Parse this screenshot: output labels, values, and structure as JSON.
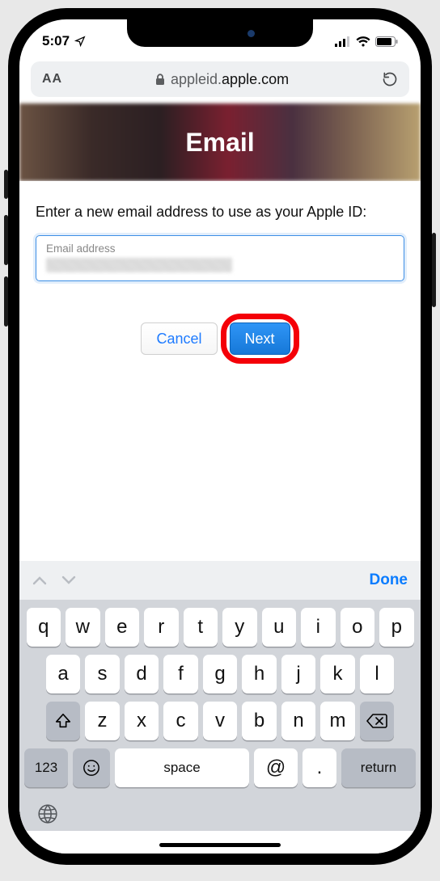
{
  "status": {
    "time": "5:07"
  },
  "urlbar": {
    "text_size_label": "AA",
    "domain_prefix": "appleid.",
    "domain_main": "apple.com"
  },
  "header": {
    "title": "Email"
  },
  "form": {
    "prompt": "Enter a new email address to use as your Apple ID:",
    "field_label": "Email address",
    "cancel_label": "Cancel",
    "next_label": "Next"
  },
  "keyboard": {
    "done_label": "Done",
    "row1": [
      "q",
      "w",
      "e",
      "r",
      "t",
      "y",
      "u",
      "i",
      "o",
      "p"
    ],
    "row2": [
      "a",
      "s",
      "d",
      "f",
      "g",
      "h",
      "j",
      "k",
      "l"
    ],
    "row3": [
      "z",
      "x",
      "c",
      "v",
      "b",
      "n",
      "m"
    ],
    "num_label": "123",
    "space_label": "space",
    "at_label": "@",
    "dot_label": ".",
    "return_label": "return"
  }
}
